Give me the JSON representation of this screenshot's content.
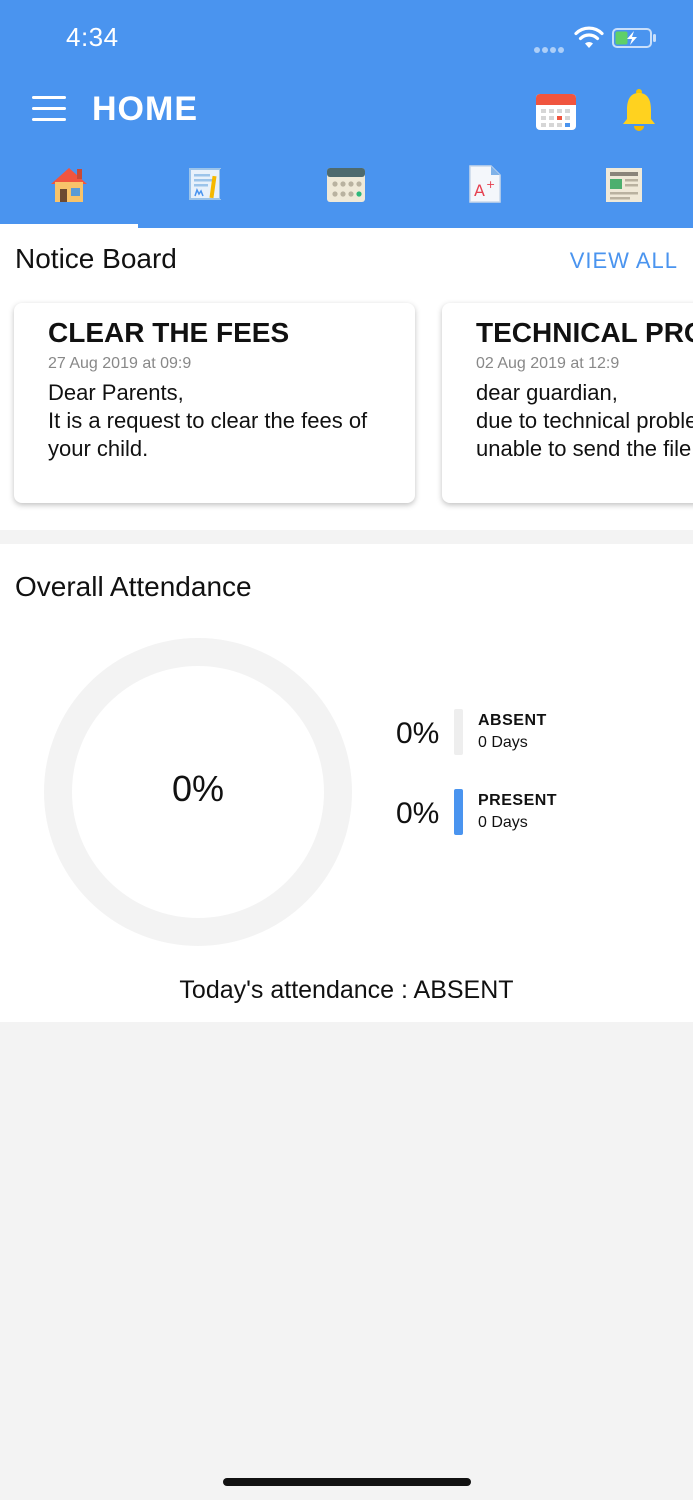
{
  "status_bar": {
    "time": "4:34"
  },
  "header": {
    "title": "HOME"
  },
  "tabs": [
    {
      "icon": "home-icon",
      "active": true
    },
    {
      "icon": "book-icon",
      "active": false
    },
    {
      "icon": "calendar-grid-icon",
      "active": false
    },
    {
      "icon": "grade-report-icon",
      "active": false
    },
    {
      "icon": "newspaper-icon",
      "active": false
    }
  ],
  "notice_board": {
    "title": "Notice Board",
    "view_all": "VIEW ALL",
    "notices": [
      {
        "title": "CLEAR THE FEES",
        "date": "27 Aug 2019 at 09:9",
        "body": "Dear Parents,\nIt is a request to clear the fees of\nyour child."
      },
      {
        "title": "TECHNICAL PROBLEM",
        "date": "02 Aug 2019 at 12:9",
        "body": "dear guardian,\ndue to technical problem\nunable to send the file"
      }
    ]
  },
  "attendance": {
    "title": "Overall Attendance",
    "center_value": "0%",
    "absent": {
      "percent": "0%",
      "label": "ABSENT",
      "days": "0 Days",
      "color": "#eeeeee"
    },
    "present": {
      "percent": "0%",
      "label": "PRESENT",
      "days": "0 Days",
      "color": "#4a94ef"
    },
    "today": "Today's attendance : ABSENT"
  },
  "colors": {
    "primary": "#4a94ef",
    "background": "#f3f3f3"
  }
}
